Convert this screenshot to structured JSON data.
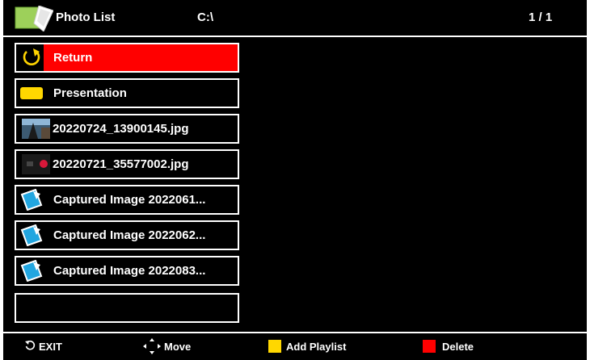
{
  "header": {
    "title": "Photo List",
    "path": "C:\\",
    "page_count": "1 / 1",
    "icon": "photo-folder-icon"
  },
  "list": {
    "items": [
      {
        "label": "Return",
        "icon": "return-icon",
        "selected": true
      },
      {
        "label": "Presentation",
        "icon": "presentation-icon",
        "selected": false
      },
      {
        "label": "20220724_13900145.jpg",
        "icon": "photo-thumbnail-icon",
        "selected": false
      },
      {
        "label": "20220721_35577002.jpg",
        "icon": "photo-thumbnail-icon",
        "selected": false
      },
      {
        "label": "Captured Image 2022061...",
        "icon": "captured-image-icon",
        "selected": false
      },
      {
        "label": "Captured Image 2022062...",
        "icon": "captured-image-icon",
        "selected": false
      },
      {
        "label": "Captured Image 2022083...",
        "icon": "captured-image-icon",
        "selected": false
      },
      {
        "label": "",
        "icon": "",
        "selected": false
      }
    ]
  },
  "footer": {
    "exit_label": "EXIT",
    "move_label": "Move",
    "add_playlist_label": "Add Playlist",
    "delete_label": "Delete"
  },
  "colors": {
    "selected": "#ff0000",
    "yellow_key": "#ffd700",
    "red_key": "#ff0000",
    "border": "#ffffff",
    "background": "#000000"
  }
}
